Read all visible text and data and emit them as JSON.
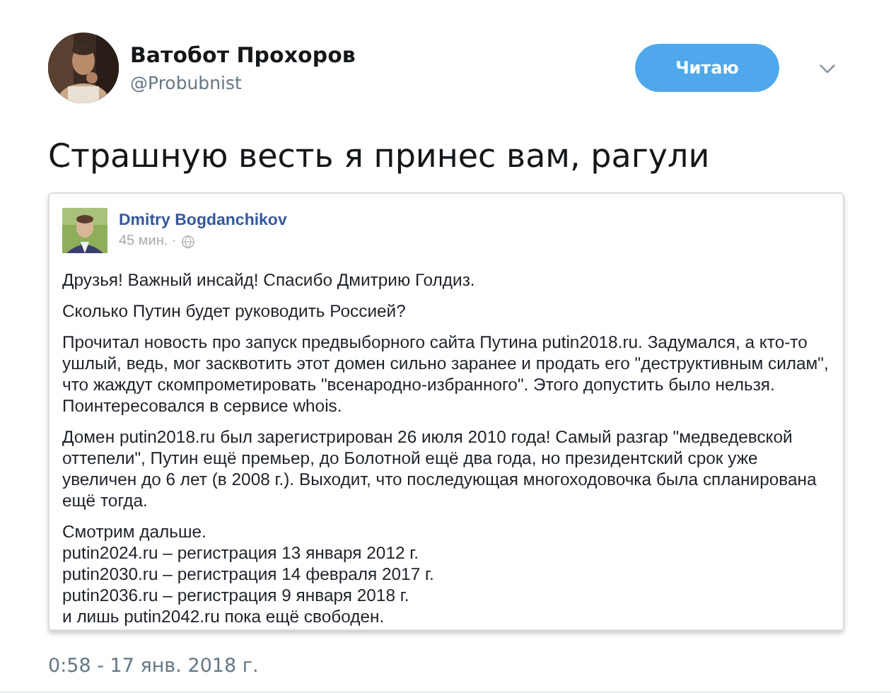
{
  "author": {
    "name": "Ватобот Прохоров",
    "handle": "@Probubnist"
  },
  "follow_button": {
    "label": "Читаю"
  },
  "tweet_text": "Страшную весть я принес вам, рагули",
  "embedded_post": {
    "author": "Dmitry Bogdanchikov",
    "time": "45 мин. ·",
    "paragraphs": [
      {
        "lines": [
          "Друзья! Важный инсайд! Спасибо Дмитрию Голдиз."
        ]
      },
      {
        "lines": [
          "Сколько Путин будет руководить Россией?"
        ]
      },
      {
        "lines": [
          "Прочитал новость про запуск предвыборного сайта Путина putin2018.ru. Задумался, а кто-то ушлый, ведь, мог засквотить этот домен сильно заранее и продать его \"деструктивным силам\", что жаждут скомпрометировать \"всенародно-избранного\". Этого допустить было нельзя. Поинтересовался в сервисе whois."
        ]
      },
      {
        "lines": [
          "Домен putin2018.ru был зарегистрирован 26 июля 2010 года! Самый разгар \"медведевской оттепели\", Путин ещё премьер, до Болотной ещё два года, но президентский срок уже увеличен до 6 лет (в 2008 г.). Выходит, что последующая многоходовочка была спланирована ещё тогда."
        ]
      },
      {
        "lines": [
          "Смотрим дальше.",
          "putin2024.ru – регистрация 13 января 2012 г.",
          "putin2030.ru – регистрация 14 февраля 2017 г.",
          "putin2036.ru – регистрация 9 января 2018 г.",
          "и лишь putin2042.ru пока ещё свободен."
        ]
      }
    ]
  },
  "timestamp": "0:58 - 17 янв. 2018 г."
}
